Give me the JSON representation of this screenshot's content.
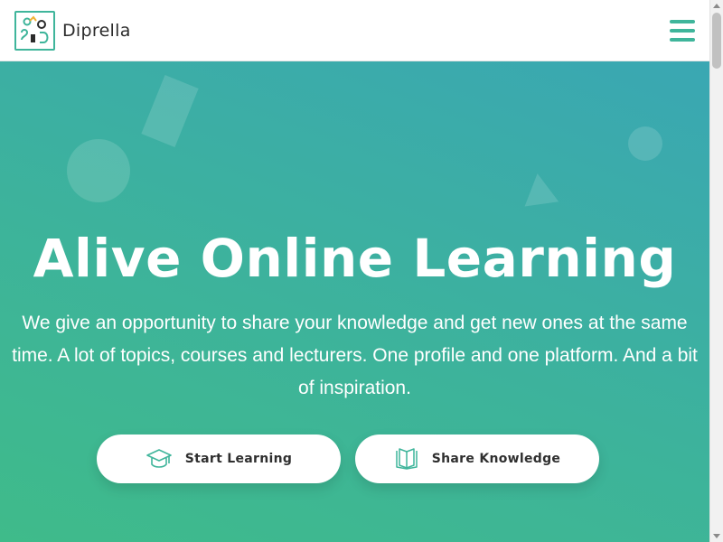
{
  "header": {
    "brand_name": "Diprella",
    "logo_icon": "diprella-logo-icon",
    "menu_icon": "hamburger-menu-icon"
  },
  "hero": {
    "title": "Alive Online Learning",
    "subtitle": "We give an opportunity to share your knowledge and get new ones at the same time. A lot of topics, courses and lecturers. One profile and one platform. And a bit of inspiration.",
    "buttons": [
      {
        "label": "Start Learning",
        "icon": "graduation-cap-icon"
      },
      {
        "label": "Share Knowledge",
        "icon": "open-book-icon"
      }
    ]
  },
  "colors": {
    "accent": "#3fb59b",
    "gradient_start": "#3fbb8a",
    "gradient_end": "#3aa7b3",
    "text_dark": "#2f2f2f"
  }
}
